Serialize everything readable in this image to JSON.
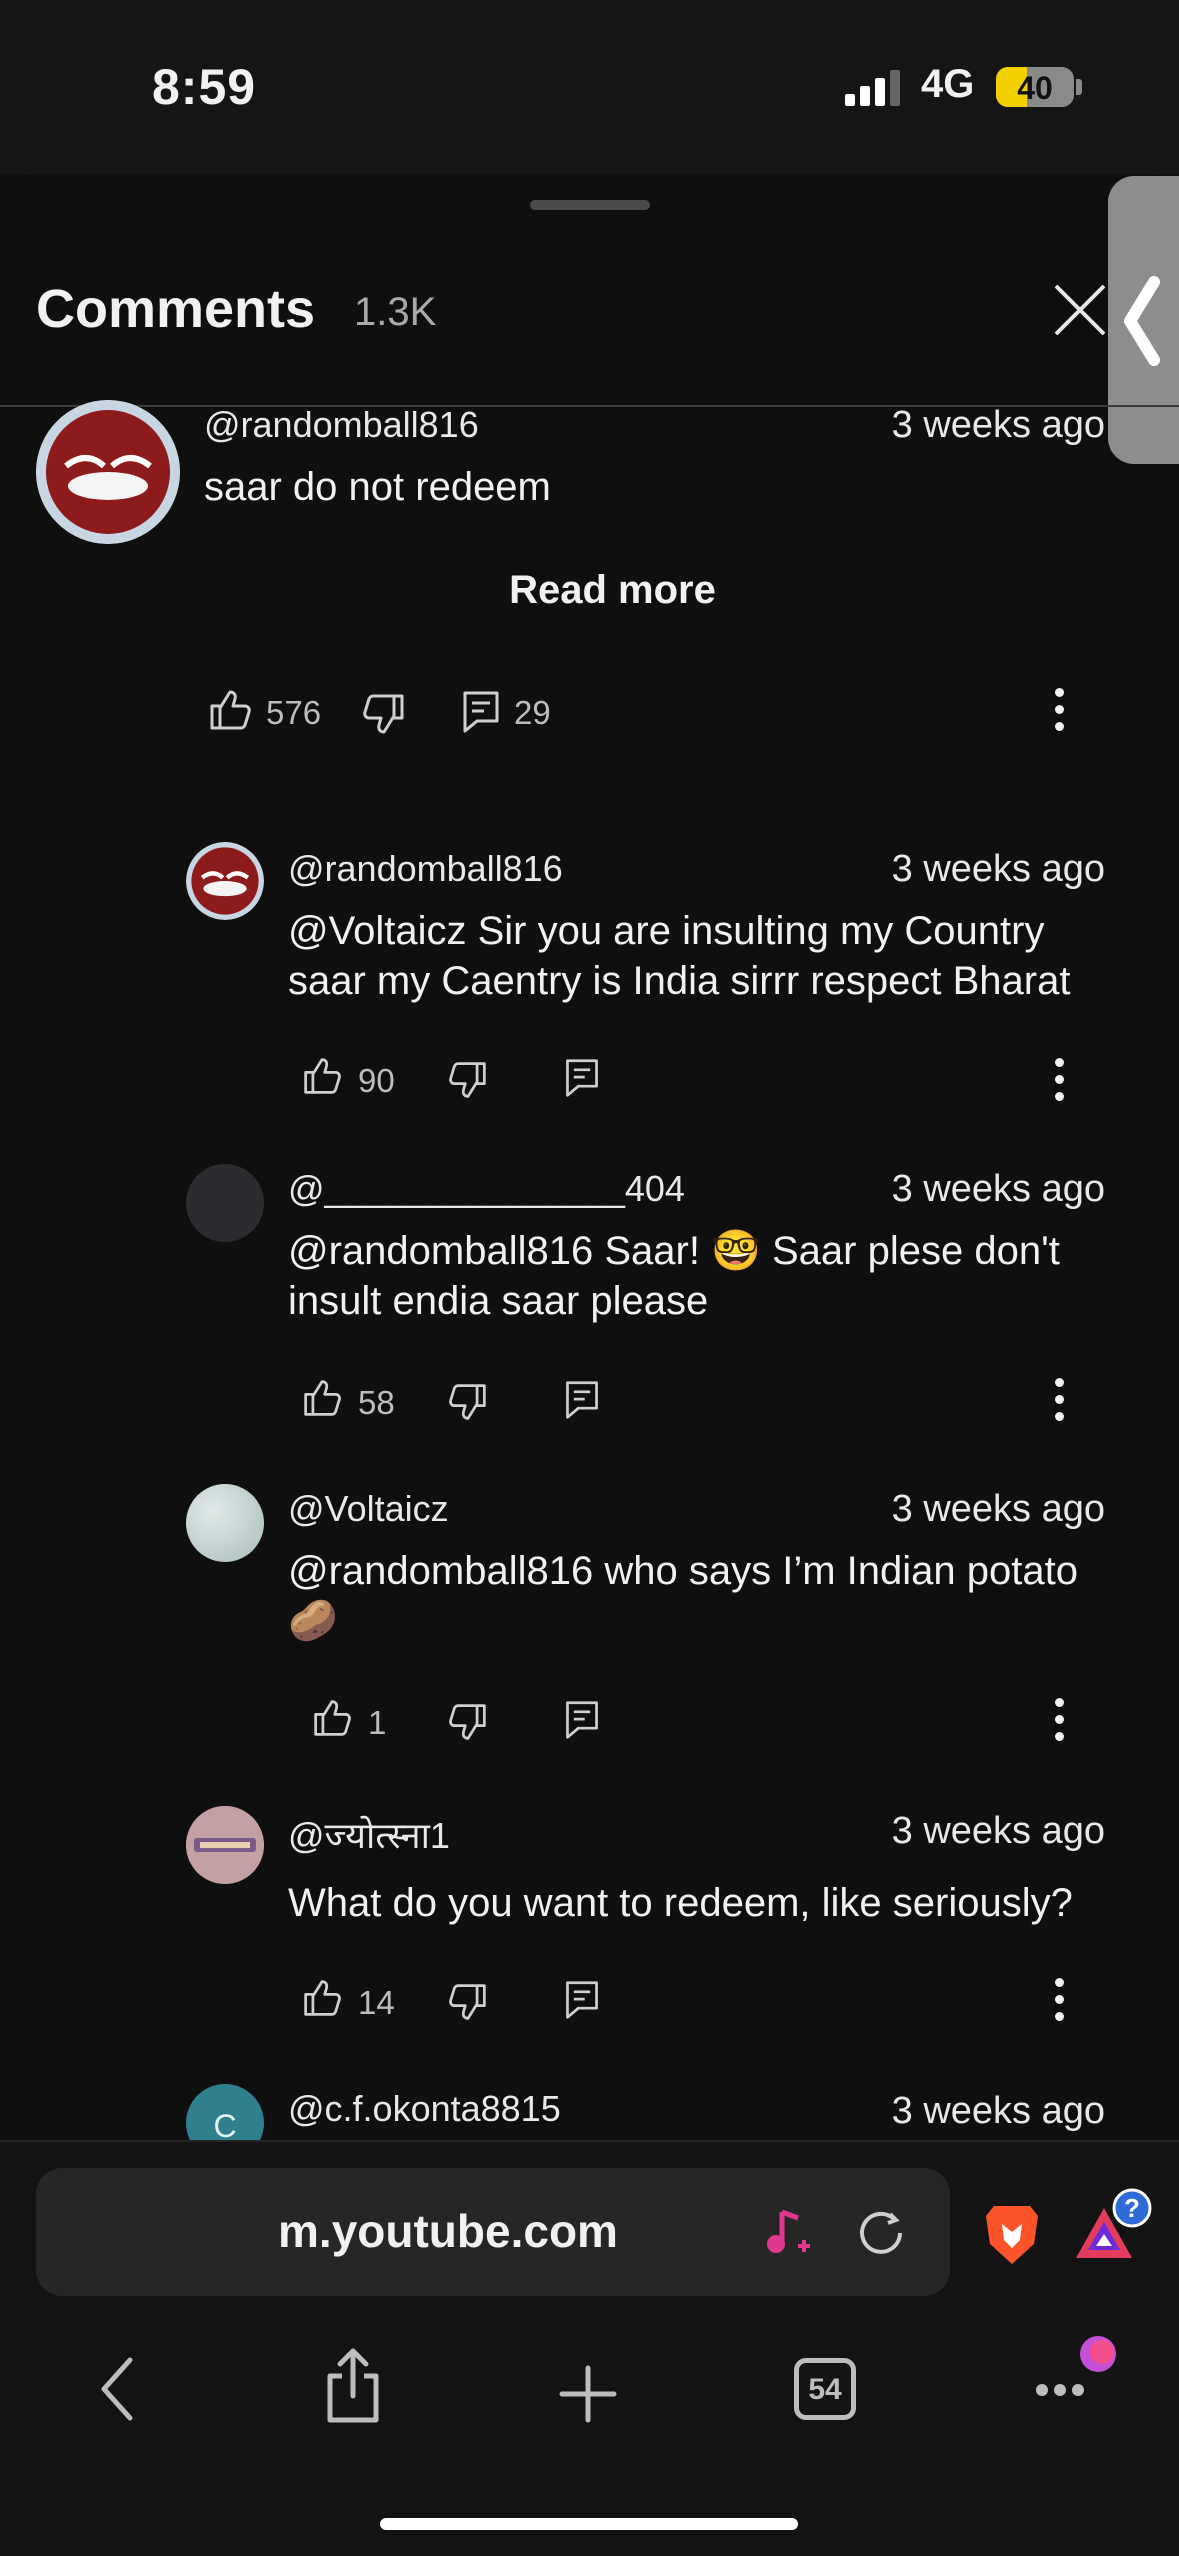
{
  "status_bar": {
    "time": "8:59",
    "network": "4G",
    "battery": "40",
    "battery_level": 0.4
  },
  "sheet": {
    "title": "Comments",
    "count": "1.3K"
  },
  "comments": [
    {
      "handle": "@randomball816",
      "time": "3 weeks ago",
      "text_lines": [
        "saar do not redeem"
      ],
      "read_more": "Read more",
      "likes": "576",
      "replies": "29"
    },
    {
      "handle": "@randomball816",
      "time": "3 weeks ago",
      "text_lines": [
        "@Voltaicz Sir you are insulting my Country",
        "saar my Caentry is India sirrr respect Bharat"
      ],
      "likes": "90"
    },
    {
      "handle": "@_______________404",
      "time": "3 weeks ago",
      "text_lines": [
        "@randomball816 Saar! 🤓 Saar plese don't",
        "insult endia saar please"
      ],
      "likes": "58"
    },
    {
      "handle": "@Voltaicz",
      "time": "3 weeks ago",
      "text_lines": [
        "@randomball816 who says I’m Indian potato",
        "🥔"
      ],
      "likes": "1"
    },
    {
      "handle": "@ज्योत्स्ना1",
      "time": "3 weeks ago",
      "text_lines": [
        "What do you want to redeem, like seriously?"
      ],
      "likes": "14"
    },
    {
      "handle": "@c.f.okonta8815",
      "time": "3 weeks ago",
      "avatar_letter": "C"
    }
  ],
  "browser": {
    "url": "m.youtube.com",
    "tab_count": "54"
  },
  "colors": {
    "background": "#0f0f0f",
    "text": "#f1f1f1",
    "secondary": "#aaaaaa",
    "battery": "#f2cf00",
    "brave": "#fb542b"
  }
}
